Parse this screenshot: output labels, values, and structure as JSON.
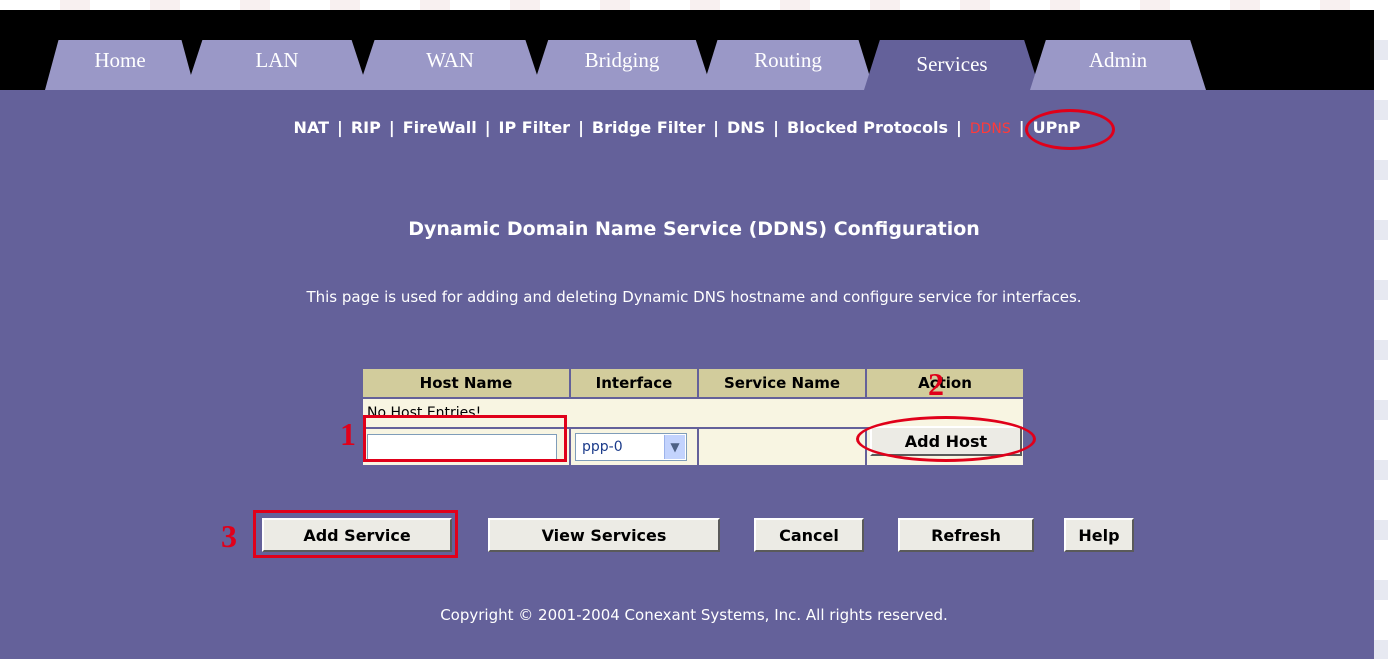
{
  "tabs": [
    "Home",
    "LAN",
    "WAN",
    "Bridging",
    "Routing",
    "Services",
    "Admin"
  ],
  "active_tab": "Services",
  "subnav": {
    "items": [
      "NAT",
      "RIP",
      "FireWall",
      "IP Filter",
      "Bridge Filter",
      "DNS",
      "Blocked Protocols",
      "DDNS",
      "UPnP"
    ],
    "current": "DDNS",
    "separator": "|"
  },
  "page": {
    "title": "Dynamic Domain Name Service (DDNS) Configuration",
    "description": "This page is used for adding and deleting Dynamic DNS hostname and configure service for interfaces."
  },
  "table": {
    "headers": [
      "Host Name",
      "Interface",
      "Service Name",
      "Action"
    ],
    "empty_message": "No Host Entries!",
    "host_input_value": "",
    "interface_selected": "ppp-0",
    "add_host_label": "Add Host"
  },
  "buttons": {
    "add_service": "Add Service",
    "view_services": "View Services",
    "cancel": "Cancel",
    "refresh": "Refresh",
    "help": "Help"
  },
  "annotations": [
    "1",
    "2",
    "3"
  ],
  "copyright": "Copyright © 2001-2004 Conexant Systems, Inc. All rights reserved.",
  "colors": {
    "background": "#64619a",
    "tab_inactive": "#9a98c7",
    "table_header": "#d2cc9c",
    "table_cell": "#f8f5e2",
    "annotation_red": "#e0001a"
  }
}
